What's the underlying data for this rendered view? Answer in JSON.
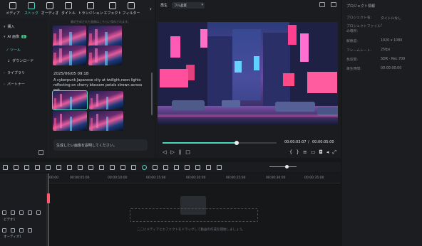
{
  "toolbar": {
    "items": [
      {
        "label": "メディア",
        "icon": "media-icon"
      },
      {
        "label": "ストック",
        "icon": "stock-icon",
        "active": true
      },
      {
        "label": "オーディオ",
        "icon": "audio-icon"
      },
      {
        "label": "タイトル",
        "icon": "title-icon"
      },
      {
        "label": "トランジション",
        "icon": "transition-icon"
      },
      {
        "label": "エフェクト",
        "icon": "effects-icon"
      },
      {
        "label": "フィルター",
        "icon": "filter-icon"
      }
    ],
    "more": "›"
  },
  "sidebar": {
    "items": [
      {
        "label": "購入"
      },
      {
        "label": "AI 画像",
        "badge": "β"
      },
      {
        "label": "ツール"
      },
      {
        "label": "ダウンロード"
      },
      {
        "label": "ライブラリ"
      },
      {
        "label": "パートナー"
      }
    ]
  },
  "gallery": {
    "note": "最近生成された画像はこちらに保存されます。",
    "date": "2025/06/05 09:18",
    "description": "A cyberpunk Japanese city at twilight,neon lights reflecting on cherry blossom petals strewn across wet...",
    "input_placeholder": "生成したい画像を説明してください。"
  },
  "preview": {
    "play_label": "再生",
    "quality": "フル品質",
    "current_time": "00:00:03:07",
    "total_time": "00:00:05:00",
    "progress": 0.65,
    "separator": "/"
  },
  "properties": {
    "title": "プロジェクト情報",
    "rows": [
      {
        "key": "プロジェクト名:",
        "value": "タイトルなし"
      },
      {
        "key": "プロジェクトファイルの場所:",
        "value": "/"
      },
      {
        "key": "解像度:",
        "value": "1920 x 1080"
      },
      {
        "key": "フレームレート:",
        "value": "25fps"
      },
      {
        "key": "色空間:",
        "value": "SDR - Rec.709"
      },
      {
        "key": "再生時間:",
        "value": "00:00:00:00"
      }
    ]
  },
  "timeline": {
    "ticks": [
      "00:00",
      "00:00:05:00",
      "00:00:10:00",
      "00:00:15:00",
      "00:00:20:00",
      "00:00:25:00",
      "00:00:30:00",
      "00:00:35:00",
      "00:00:40:00",
      "00:00:45:00"
    ],
    "tracks": [
      {
        "name": "ビデオ1"
      },
      {
        "name": "オーディオ1"
      }
    ],
    "drop_hint": "ここにメディアとエフェクトをドラッグして動画の作成を開始しましょう。"
  }
}
